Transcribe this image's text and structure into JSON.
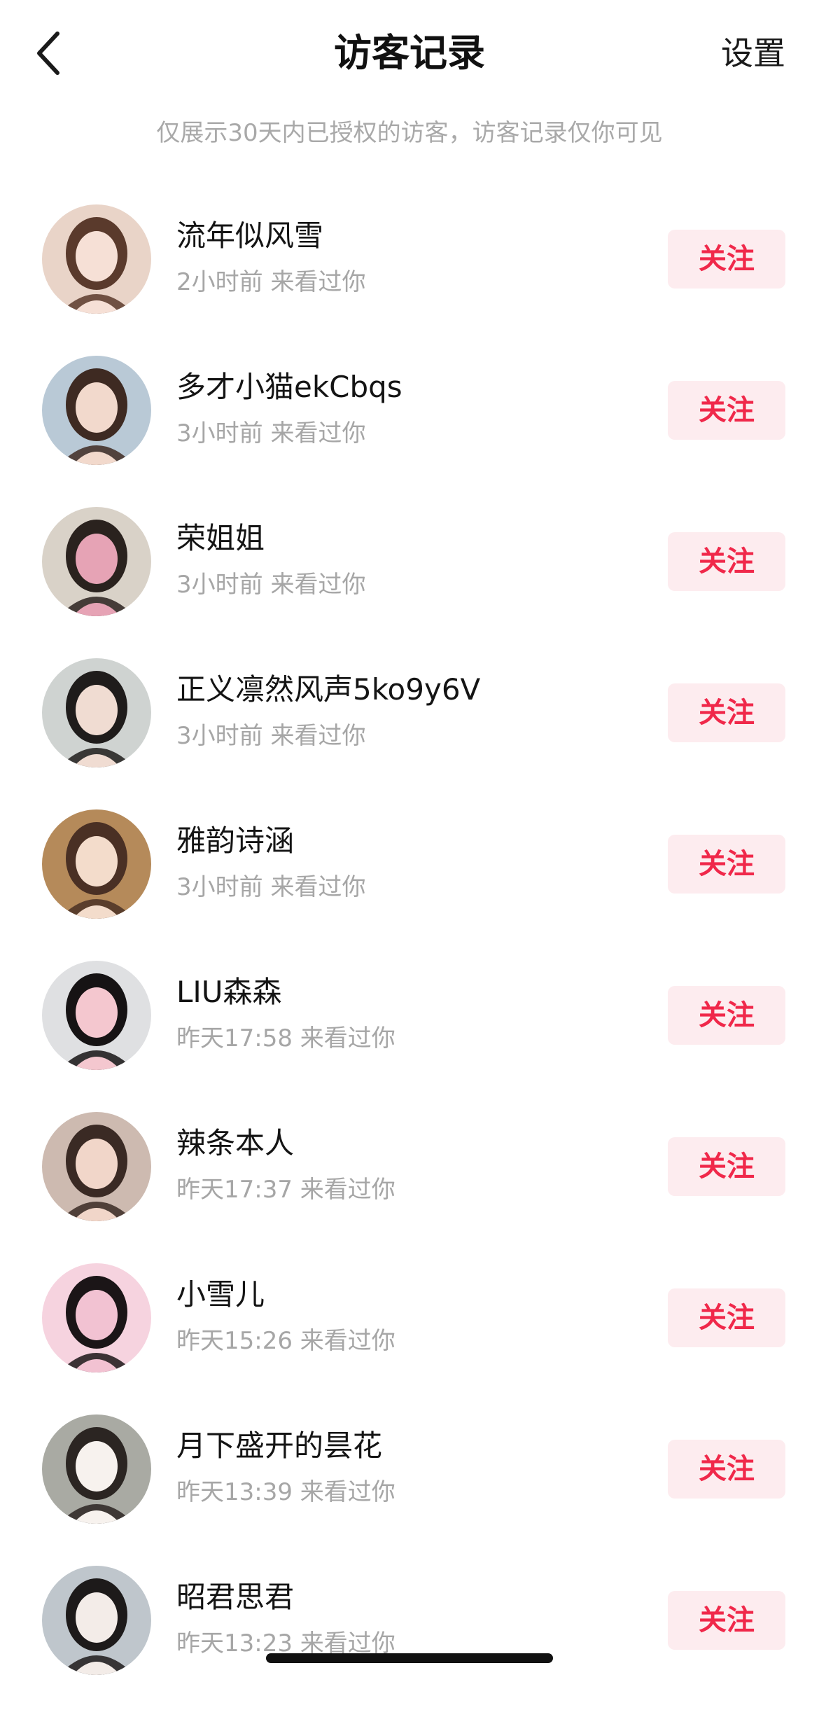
{
  "header": {
    "back_icon": "chevron-left-icon",
    "title": "访客记录",
    "settings_label": "设置"
  },
  "notice": "仅展示30天内已授权的访客，访客记录仅你可见",
  "visitors": [
    {
      "name": "流年似风雪",
      "visit": "2小时前 来看过你",
      "follow_label": "关注",
      "avatar_colors": [
        "#e9d4c8",
        "#5a3a2c",
        "#f6e0d6"
      ]
    },
    {
      "name": "多才小猫ekCbqs",
      "visit": "3小时前 来看过你",
      "follow_label": "关注",
      "avatar_colors": [
        "#b9c9d6",
        "#3e2a22",
        "#f2d9cc"
      ]
    },
    {
      "name": "荣姐姐",
      "visit": "3小时前 来看过你",
      "follow_label": "关注",
      "avatar_colors": [
        "#d9d2c8",
        "#2a221e",
        "#e6a3b5"
      ]
    },
    {
      "name": "正义凛然风声5ko9y6V",
      "visit": "3小时前 来看过你",
      "follow_label": "关注",
      "avatar_colors": [
        "#cfd3d1",
        "#1f1c1b",
        "#f0dcd2"
      ]
    },
    {
      "name": "雅韵诗涵",
      "visit": "3小时前 来看过你",
      "follow_label": "关注",
      "avatar_colors": [
        "#b58a5a",
        "#4a3024",
        "#f3dccb"
      ]
    },
    {
      "name": "LIU森森",
      "visit": "昨天17:58 来看过你",
      "follow_label": "关注",
      "avatar_colors": [
        "#dfe0e2",
        "#161314",
        "#f4c7cf"
      ]
    },
    {
      "name": "辣条本人",
      "visit": "昨天17:37 来看过你",
      "follow_label": "关注",
      "avatar_colors": [
        "#cdbab0",
        "#3a2a24",
        "#f1d6c9"
      ]
    },
    {
      "name": "小雪儿",
      "visit": "昨天15:26 来看过你",
      "follow_label": "关注",
      "avatar_colors": [
        "#f6d3df",
        "#1b1517",
        "#f2c2d2"
      ]
    },
    {
      "name": "月下盛开的昙花",
      "visit": "昨天13:39 来看过你",
      "follow_label": "关注",
      "avatar_colors": [
        "#a9aaa3",
        "#2b2522",
        "#f7f2ee"
      ]
    },
    {
      "name": "昭君思君",
      "visit": "昨天13:23 来看过你",
      "follow_label": "关注",
      "avatar_colors": [
        "#bfc6cc",
        "#1d1a1a",
        "#f3ece8"
      ]
    }
  ],
  "colors": {
    "accent": "#f0284a",
    "follow_bg": "#fdecef",
    "muted_text": "#a6a6a6"
  }
}
